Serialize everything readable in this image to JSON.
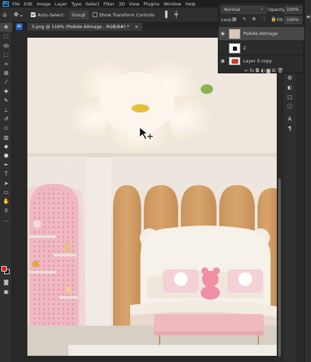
{
  "app": {
    "logo_text": "Ps"
  },
  "menu": [
    "File",
    "Edit",
    "Image",
    "Layer",
    "Type",
    "Select",
    "Filter",
    "3D",
    "View",
    "Plugins",
    "Window",
    "Help"
  ],
  "options_bar": {
    "auto_select_label": "Auto-Select:",
    "auto_select_checked": true,
    "auto_select_target": "Group",
    "show_transform_label": "Show Transform Controls",
    "show_transform_checked": false
  },
  "document": {
    "tab_title": "3.png @ 116% (PsAide AIImage , RGB/8#) *",
    "close_symbol": "×",
    "left_icon_text": "AI"
  },
  "layers_panel": {
    "blend_mode": "Normal",
    "opacity_label": "Opacity:",
    "opacity_value": "100%",
    "lock_label": "Lock:",
    "lock_icons": "▦ ✎ ✥ ⛶ 🔒",
    "fill_label": "Fill:",
    "fill_value": "100%",
    "layers": [
      {
        "name": "PsAide AIImage",
        "visible": true,
        "selected": true
      },
      {
        "name": "2",
        "visible": false,
        "selected": false
      },
      {
        "name": "Layer 0 copy",
        "visible": true,
        "selected": false
      }
    ],
    "footer_icons": "∞ fx ◘ ◐ ▆ ⊞ 🗑"
  },
  "colors": {
    "foreground": "#e21a1a",
    "background": "#1a1a1a",
    "accent": "#31a8ff"
  }
}
